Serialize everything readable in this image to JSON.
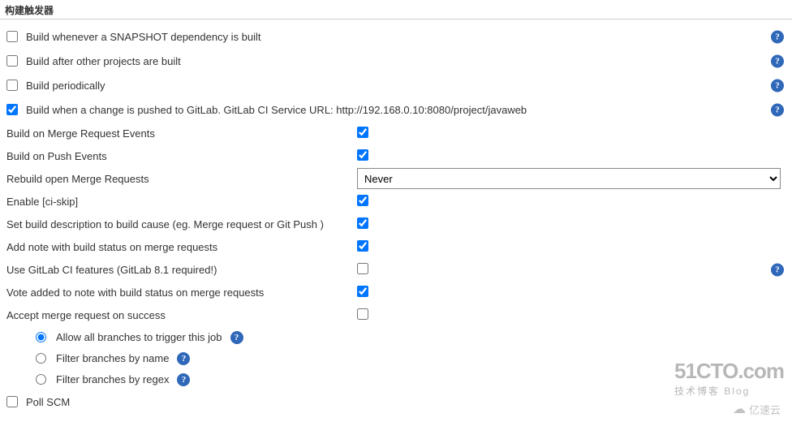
{
  "section_title": "构建触发器",
  "triggers": {
    "snapshot": {
      "label": "Build whenever a SNAPSHOT dependency is built",
      "checked": false
    },
    "after_other": {
      "label": "Build after other projects are built",
      "checked": false
    },
    "periodically": {
      "label": "Build periodically",
      "checked": false
    },
    "gitlab_push": {
      "label": "Build when a change is pushed to GitLab. GitLab CI Service URL: http://192.168.0.10:8080/project/javaweb",
      "checked": true
    },
    "poll_scm": {
      "label": "Poll SCM",
      "checked": false
    }
  },
  "gitlab_opts": {
    "merge_events": {
      "label": "Build on Merge Request Events",
      "checked": true
    },
    "push_events": {
      "label": "Build on Push Events",
      "checked": true
    },
    "rebuild_mr": {
      "label": "Rebuild open Merge Requests",
      "selected": "Never",
      "options": [
        "Never"
      ]
    },
    "ci_skip": {
      "label": "Enable [ci-skip]",
      "checked": true
    },
    "set_desc": {
      "label": "Set build description to build cause (eg. Merge request or Git Push )",
      "checked": true
    },
    "add_note": {
      "label": "Add note with build status on merge requests",
      "checked": true
    },
    "ci_features": {
      "label": "Use GitLab CI features (GitLab 8.1 required!)",
      "checked": false
    },
    "vote_note": {
      "label": "Vote added to note with build status on merge requests",
      "checked": true
    },
    "accept_mr": {
      "label": "Accept merge request on success",
      "checked": false
    }
  },
  "branch_filter": {
    "allow_all": "Allow all branches to trigger this job",
    "by_name": "Filter branches by name",
    "by_regex": "Filter branches by regex",
    "selected": "allow_all"
  },
  "watermarks": {
    "w1_line1": "51CTO.com",
    "w1_line2": "技术博客   Blog",
    "w2": "亿速云"
  }
}
